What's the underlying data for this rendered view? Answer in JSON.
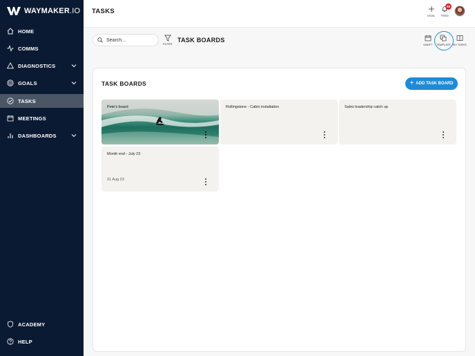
{
  "brand": {
    "name_bold": "WAYMAKER",
    "name_light": ".IO"
  },
  "sidebar": {
    "items": [
      {
        "label": "HOME",
        "icon": "home-icon"
      },
      {
        "label": "COMMS",
        "icon": "pulse-icon"
      },
      {
        "label": "DIAGNOSTICS",
        "icon": "triangle-icon",
        "has_children": true
      },
      {
        "label": "GOALS",
        "icon": "target-icon",
        "has_children": true
      },
      {
        "label": "TASKS",
        "icon": "check-circle-icon",
        "active": true
      },
      {
        "label": "MEETINGS",
        "icon": "calendar-icon"
      },
      {
        "label": "DASHBOARDS",
        "icon": "bar-chart-icon",
        "has_children": true
      }
    ],
    "bottom_items": [
      {
        "label": "ACADEMY",
        "icon": "shield-icon"
      },
      {
        "label": "HELP",
        "icon": "help-icon"
      }
    ]
  },
  "header": {
    "title": "TASKS",
    "goal_label": "GOAL",
    "feed_label": "FEED",
    "feed_count": "58"
  },
  "toolbar": {
    "search_placeholder": "Search...",
    "filter_label": "FILTER",
    "section_title": "TASK BOARDS",
    "views": {
      "gantt": "GANTT",
      "template": "TEMPLATE",
      "my_tasks": "MY TASKS"
    }
  },
  "panel": {
    "title": "TASK BOARDS",
    "add_label": "ADD TASK BOARD",
    "boards": [
      {
        "name": "Pete's board",
        "date": "",
        "has_image": true
      },
      {
        "name": "Rollingstone - Cabin installation",
        "date": ""
      },
      {
        "name": "Sales leadership catch up",
        "date": ""
      },
      {
        "name": "Month end - July 23",
        "date": "31 Aug 23"
      }
    ]
  },
  "colors": {
    "sidebar": "#0b1a33",
    "active": "#4a5566",
    "accent": "#1f8bd6",
    "badge": "#d2232a",
    "card": "#f4f2ee"
  }
}
